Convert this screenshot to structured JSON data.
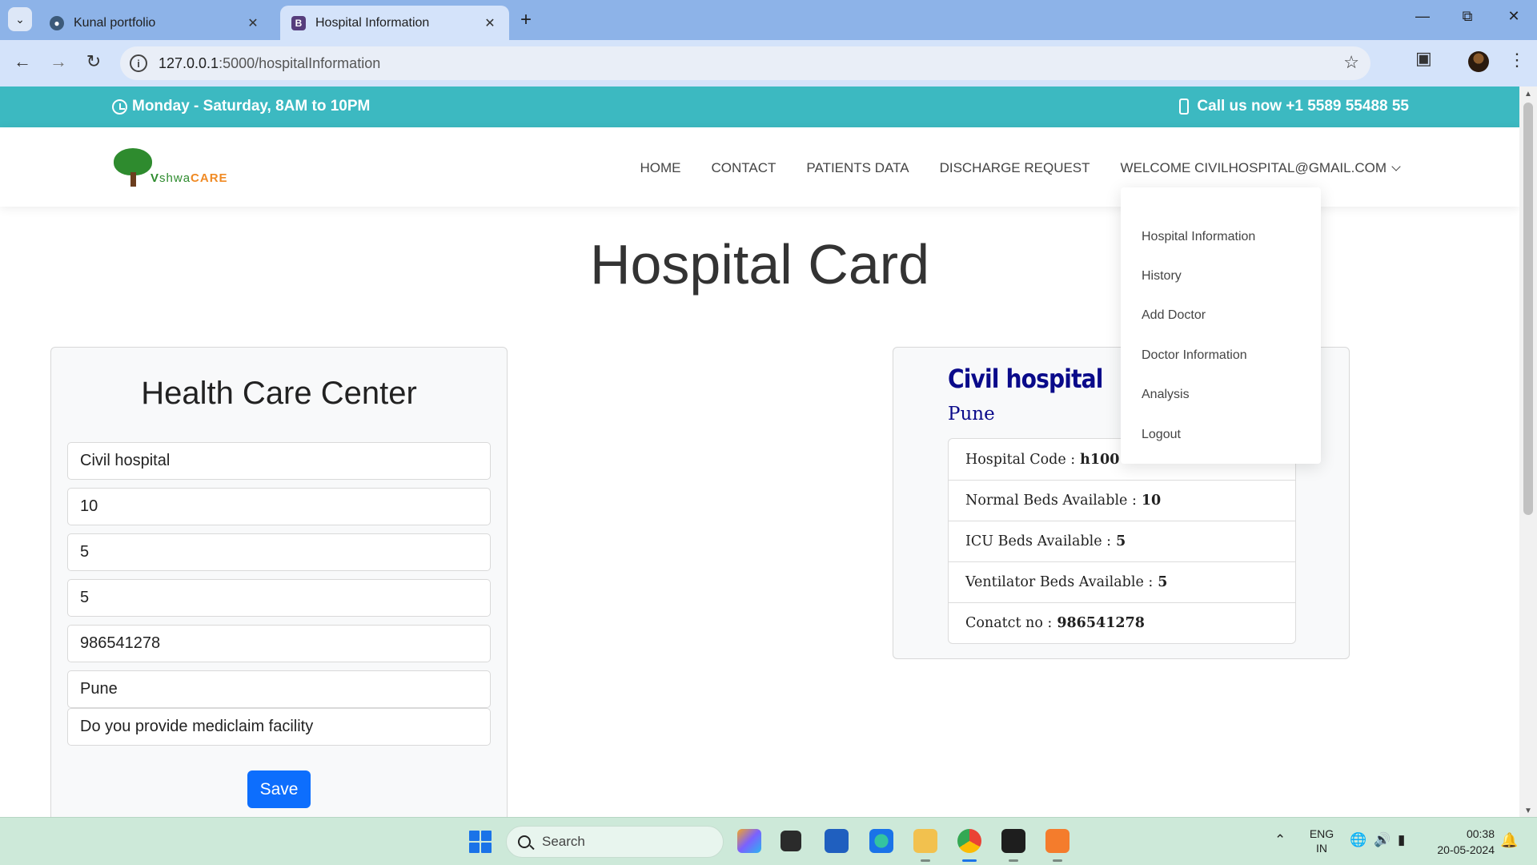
{
  "browser": {
    "tabs": [
      {
        "title": "Kunal portfolio",
        "favicon": "globe-icon",
        "active": false
      },
      {
        "title": "Hospital Information",
        "favicon": "B",
        "active": true
      }
    ],
    "url_host": "127.0.0.1",
    "url_path": ":5000/hospitalInformation"
  },
  "topbar": {
    "hours": "Monday - Saturday, 8AM to 10PM",
    "call": "Call us now +1 5589 55488 55"
  },
  "logo": {
    "v": "V",
    "middle": "shwa",
    "care": "CARE"
  },
  "nav": {
    "home": "HOME",
    "contact": "CONTACT",
    "patients": "PATIENTS DATA",
    "discharge": "DISCHARGE REQUEST",
    "welcome": "WELCOME CIVILHOSPITAL@GMAIL.COM"
  },
  "dropdown": {
    "items": [
      "Hospital Information",
      "History",
      "Add Doctor",
      "Doctor Information",
      "Analysis",
      "Logout"
    ]
  },
  "page_title": "Hospital Card",
  "form": {
    "title": "Health Care Center",
    "fields": [
      "Civil hospital",
      "10",
      "5",
      "5",
      "986541278",
      "Pune",
      "Do you provide mediclaim facility"
    ],
    "save_label": "Save"
  },
  "card": {
    "name": "Civil hospital",
    "city": "Pune",
    "rows": [
      {
        "label": "Hospital Code :",
        "value": "h100"
      },
      {
        "label": "Normal Beds Available :",
        "value": "10"
      },
      {
        "label": "ICU Beds Available :",
        "value": "5"
      },
      {
        "label": "Ventilator Beds Available :",
        "value": "5"
      },
      {
        "label": "Conatct no :",
        "value": "986541278"
      }
    ]
  },
  "taskbar": {
    "search_label": "Search",
    "lang_1": "ENG",
    "lang_2": "IN",
    "time": "00:38",
    "date": "20-05-2024"
  },
  "colors": {
    "topbar": "#3cb9c1",
    "brand_navy": "#0a0a8a",
    "primary_button": "#0d6efd",
    "tabbar": "#8db3e8"
  }
}
